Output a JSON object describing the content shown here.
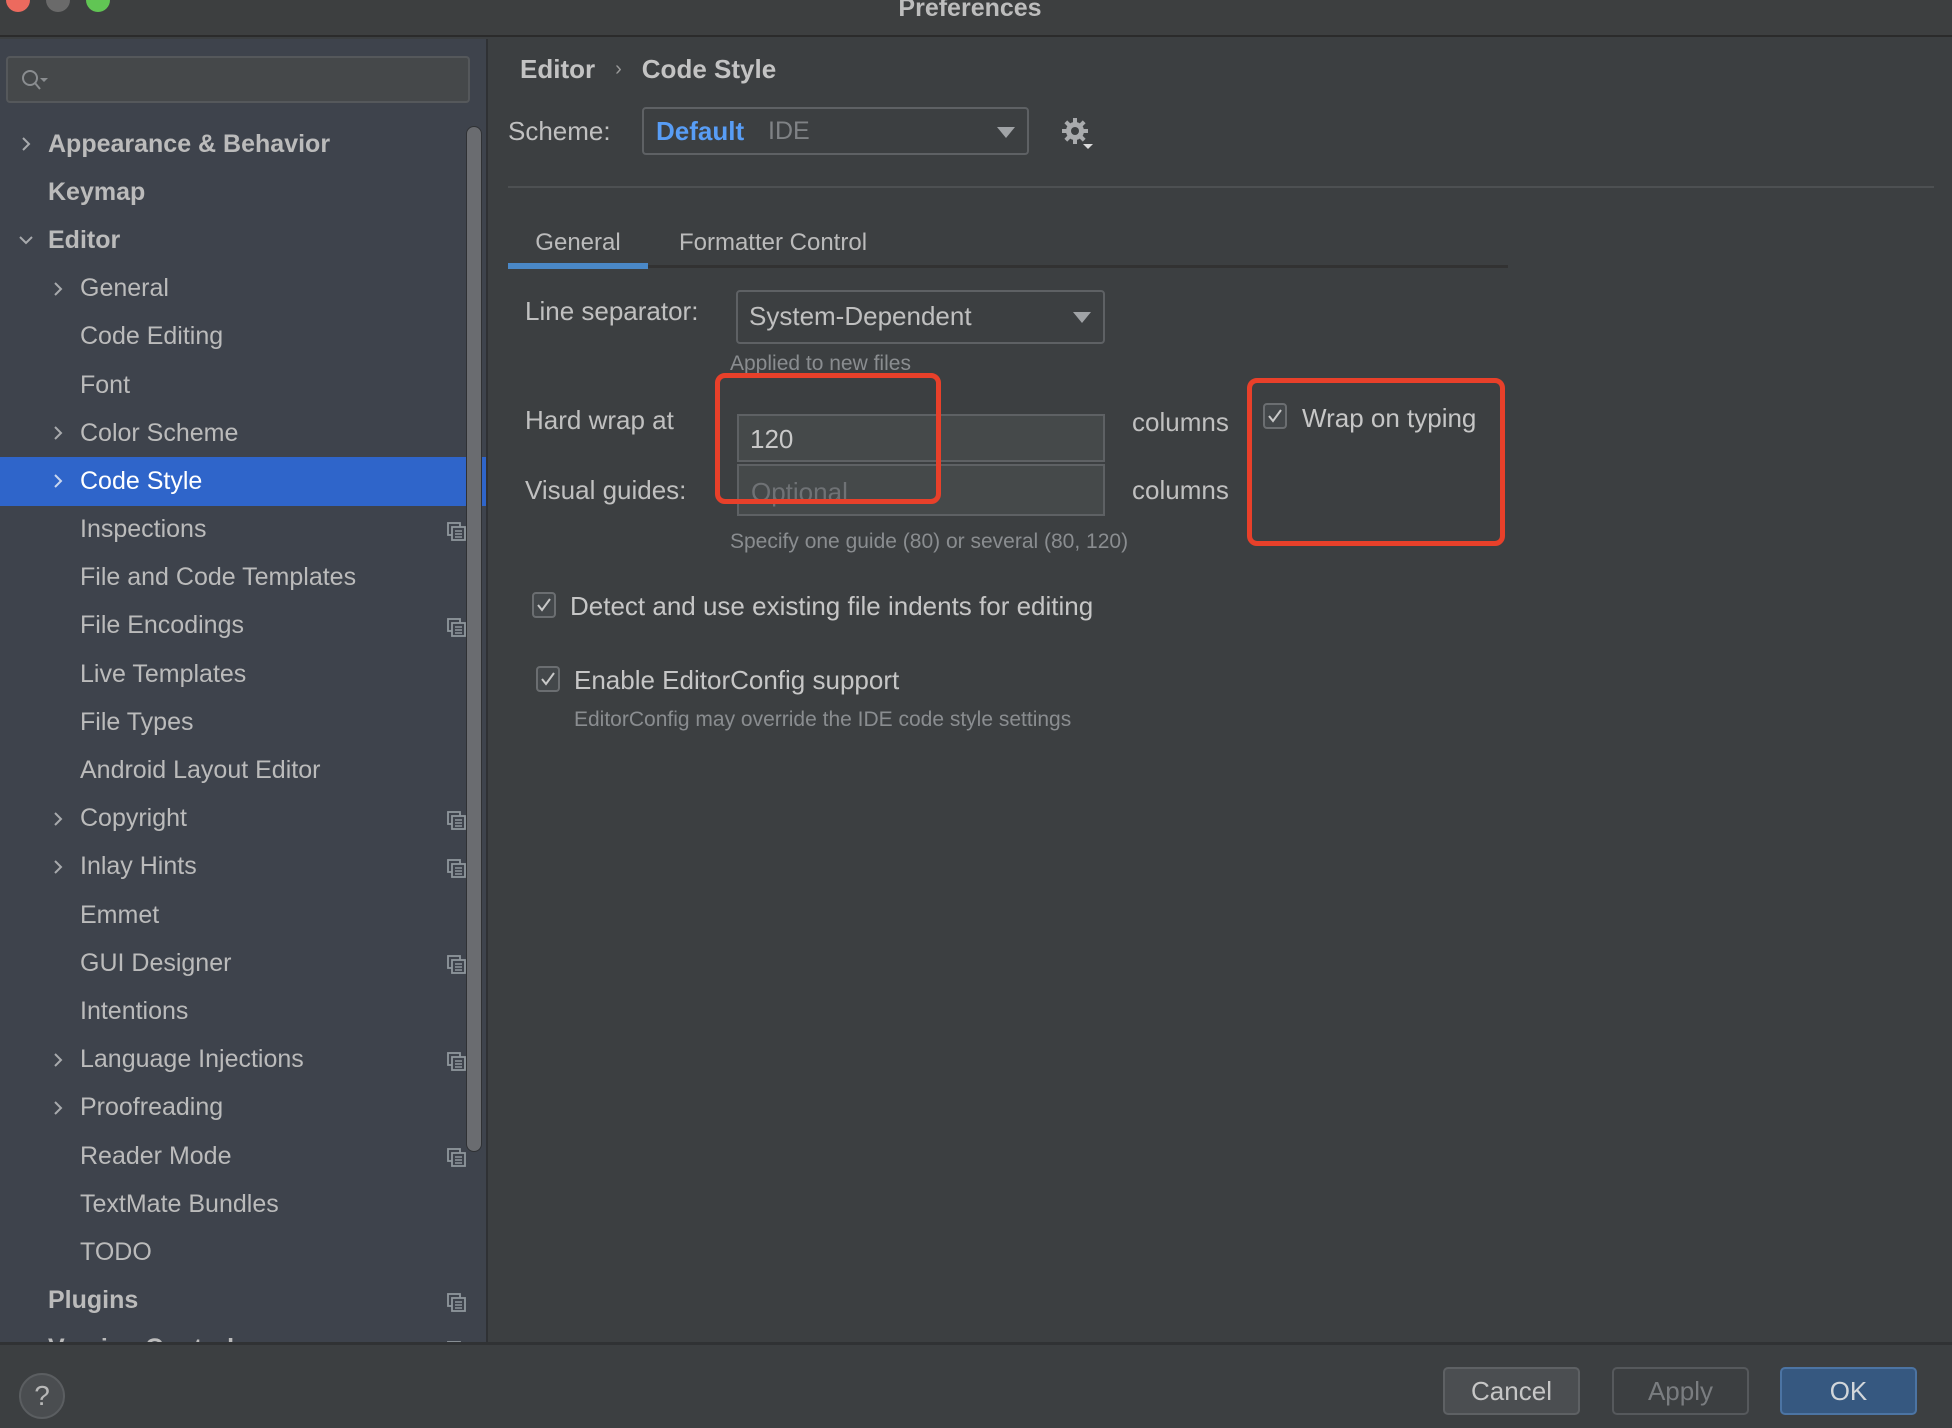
{
  "window": {
    "title": "Preferences"
  },
  "sidebar": {
    "search": {
      "value": "",
      "placeholder": ""
    },
    "items": [
      {
        "label": "Appearance & Behavior",
        "level": 0,
        "expander": "collapsed",
        "project_icon": false,
        "selected": false
      },
      {
        "label": "Keymap",
        "level": 0,
        "expander": "none",
        "project_icon": false,
        "selected": false
      },
      {
        "label": "Editor",
        "level": 0,
        "expander": "expanded",
        "project_icon": false,
        "selected": false
      },
      {
        "label": "General",
        "level": 1,
        "expander": "collapsed",
        "project_icon": false,
        "selected": false
      },
      {
        "label": "Code Editing",
        "level": 1,
        "expander": "none",
        "project_icon": false,
        "selected": false
      },
      {
        "label": "Font",
        "level": 1,
        "expander": "none",
        "project_icon": false,
        "selected": false
      },
      {
        "label": "Color Scheme",
        "level": 1,
        "expander": "collapsed",
        "project_icon": false,
        "selected": false
      },
      {
        "label": "Code Style",
        "level": 1,
        "expander": "collapsed",
        "project_icon": false,
        "selected": true
      },
      {
        "label": "Inspections",
        "level": 1,
        "expander": "none",
        "project_icon": true,
        "selected": false
      },
      {
        "label": "File and Code Templates",
        "level": 1,
        "expander": "none",
        "project_icon": false,
        "selected": false
      },
      {
        "label": "File Encodings",
        "level": 1,
        "expander": "none",
        "project_icon": true,
        "selected": false
      },
      {
        "label": "Live Templates",
        "level": 1,
        "expander": "none",
        "project_icon": false,
        "selected": false
      },
      {
        "label": "File Types",
        "level": 1,
        "expander": "none",
        "project_icon": false,
        "selected": false
      },
      {
        "label": "Android Layout Editor",
        "level": 1,
        "expander": "none",
        "project_icon": false,
        "selected": false
      },
      {
        "label": "Copyright",
        "level": 1,
        "expander": "collapsed",
        "project_icon": true,
        "selected": false
      },
      {
        "label": "Inlay Hints",
        "level": 1,
        "expander": "collapsed",
        "project_icon": true,
        "selected": false
      },
      {
        "label": "Emmet",
        "level": 1,
        "expander": "none",
        "project_icon": false,
        "selected": false
      },
      {
        "label": "GUI Designer",
        "level": 1,
        "expander": "none",
        "project_icon": true,
        "selected": false
      },
      {
        "label": "Intentions",
        "level": 1,
        "expander": "none",
        "project_icon": false,
        "selected": false
      },
      {
        "label": "Language Injections",
        "level": 1,
        "expander": "collapsed",
        "project_icon": true,
        "selected": false
      },
      {
        "label": "Proofreading",
        "level": 1,
        "expander": "collapsed",
        "project_icon": false,
        "selected": false
      },
      {
        "label": "Reader Mode",
        "level": 1,
        "expander": "none",
        "project_icon": true,
        "selected": false
      },
      {
        "label": "TextMate Bundles",
        "level": 1,
        "expander": "none",
        "project_icon": false,
        "selected": false
      },
      {
        "label": "TODO",
        "level": 1,
        "expander": "none",
        "project_icon": false,
        "selected": false
      },
      {
        "label": "Plugins",
        "level": 0,
        "expander": "none",
        "project_icon": true,
        "selected": false
      },
      {
        "label": "Version Control",
        "level": 0,
        "expander": "collapsed",
        "project_icon": true,
        "selected": false
      }
    ]
  },
  "main": {
    "breadcrumb": [
      "Editor",
      "Code Style"
    ],
    "breadcrumb_separator": "›",
    "scheme": {
      "label": "Scheme:",
      "name": "Default",
      "kind": "IDE"
    },
    "tabs": [
      {
        "label": "General",
        "active": true
      },
      {
        "label": "Formatter Control",
        "active": false
      }
    ],
    "line_separator": {
      "label": "Line separator:",
      "value": "System-Dependent",
      "hint": "Applied to new files"
    },
    "hard_wrap": {
      "label": "Hard wrap at",
      "value": "120",
      "unit": "columns"
    },
    "wrap_on_typing": {
      "label": "Wrap on typing",
      "checked": true
    },
    "visual_guides": {
      "label": "Visual guides:",
      "value": "",
      "placeholder": "Optional",
      "unit": "columns",
      "hint": "Specify one guide (80) or several (80, 120)"
    },
    "detect_indents": {
      "label": "Detect and use existing file indents for editing",
      "checked": true
    },
    "editorconfig": {
      "label": "Enable EditorConfig support",
      "checked": true,
      "hint": "EditorConfig may override the IDE code style settings"
    }
  },
  "footer": {
    "help_label": "?",
    "cancel_label": "Cancel",
    "apply_label": "Apply",
    "ok_label": "OK"
  },
  "colors": {
    "accent_selection": "#2f65ca",
    "scheme_name": "#589df6",
    "tab_underline": "#4a88c7",
    "highlight_annotation": "#e8402a",
    "ok_button": "#365880"
  }
}
